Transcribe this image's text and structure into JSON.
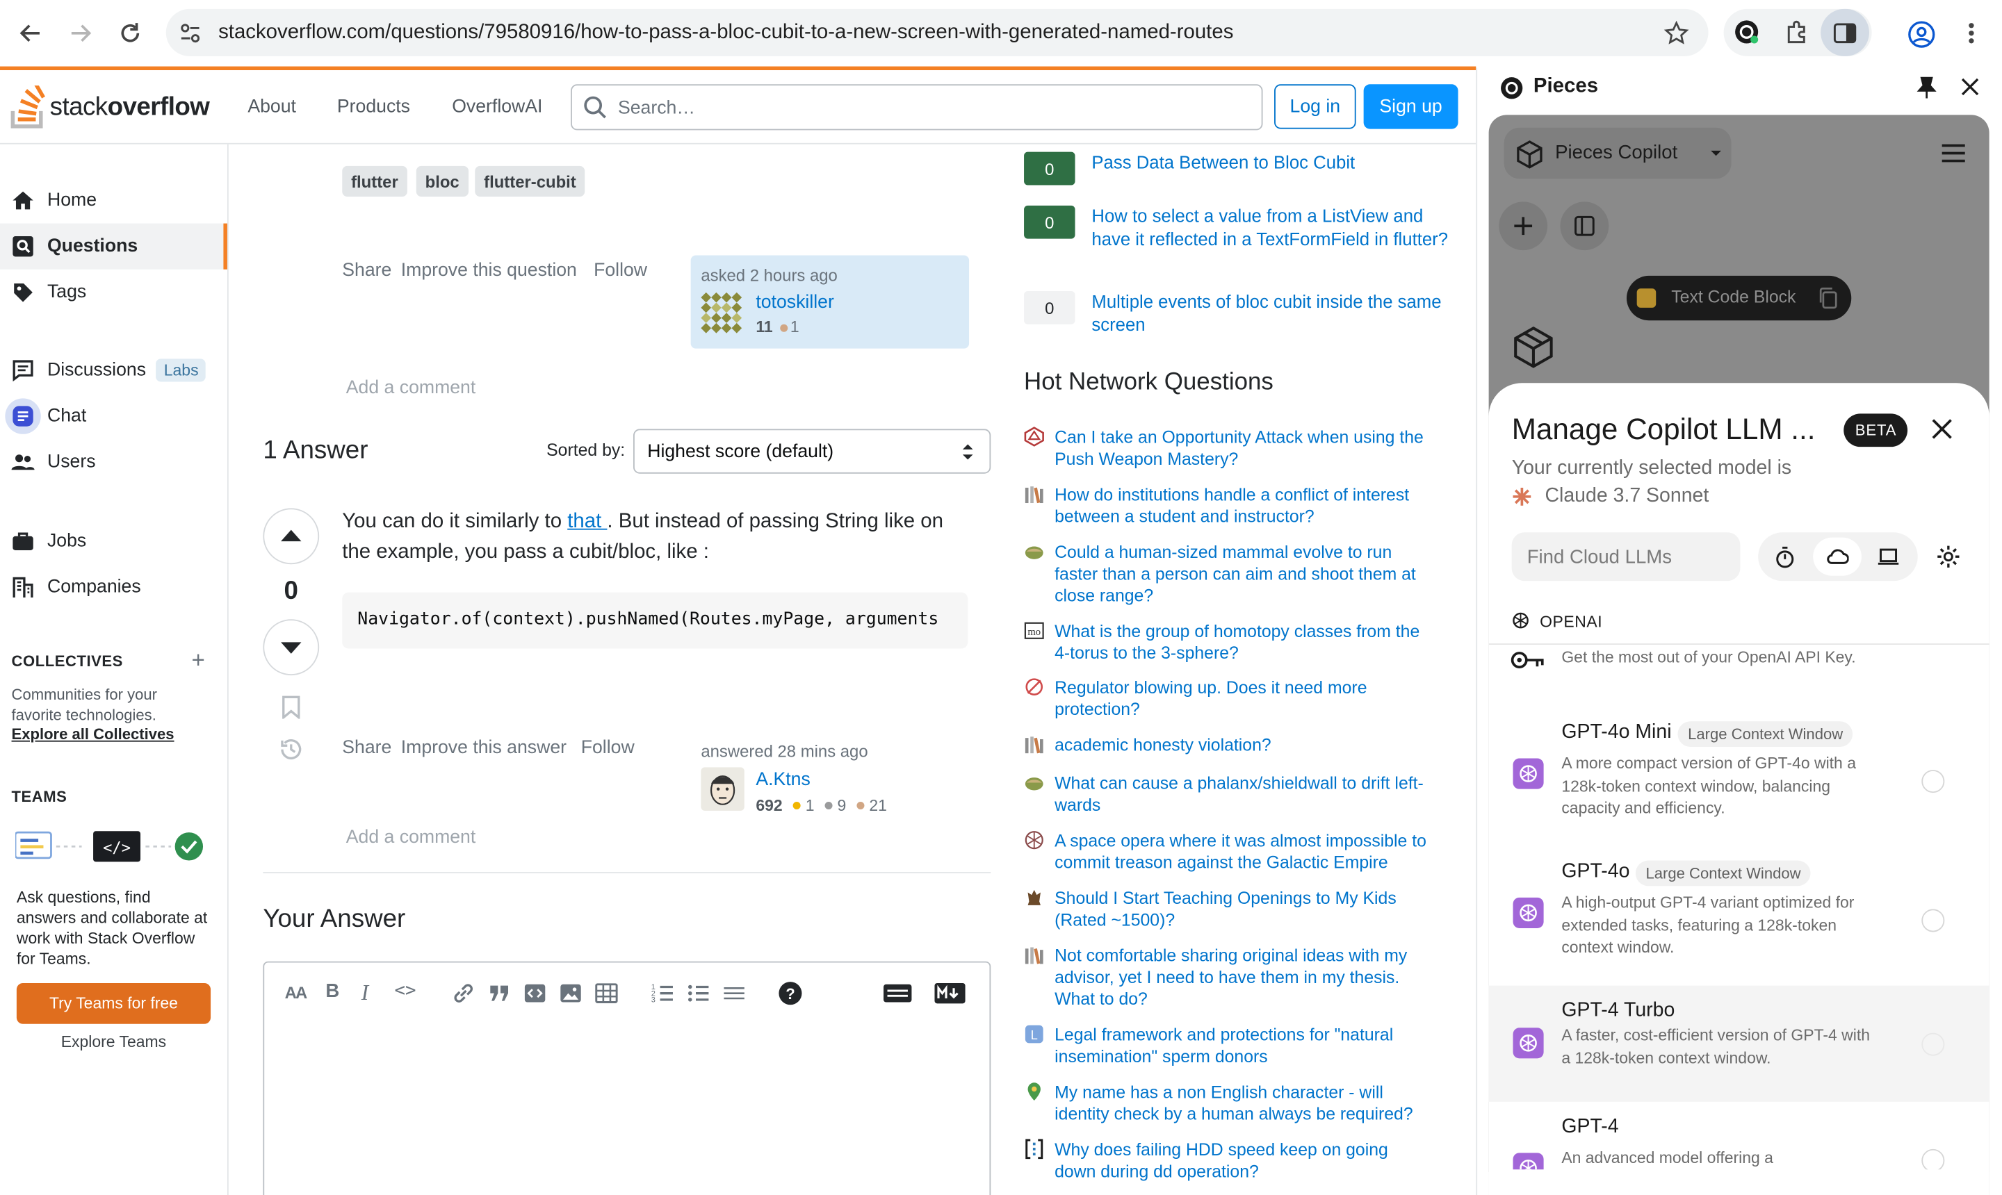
{
  "browser": {
    "url": "stackoverflow.com/questions/79580916/how-to-pass-a-bloc-cubit-to-a-new-screen-with-generated-named-routes"
  },
  "so": {
    "logo_text_a": "stack",
    "logo_text_b": "overflow",
    "nav": [
      "About",
      "Products",
      "OverflowAI"
    ],
    "search_placeholder": "Search…",
    "login": "Log in",
    "signup": "Sign up",
    "leftnav": {
      "home": "Home",
      "questions": "Questions",
      "tags": "Tags",
      "discussions": "Discussions",
      "labs": "Labs",
      "chat": "Chat",
      "users": "Users",
      "jobs": "Jobs",
      "companies": "Companies"
    },
    "collectives": {
      "title": "COLLECTIVES",
      "desc": "Communities for your favorite technologies.",
      "link": "Explore all Collectives"
    },
    "teams": {
      "title": "TEAMS",
      "desc": "Ask questions, find answers and collaborate at work with Stack Overflow for Teams.",
      "cta": "Try Teams for free",
      "explore": "Explore Teams"
    },
    "question": {
      "tags": [
        "flutter",
        "bloc",
        "flutter-cubit"
      ],
      "share": "Share",
      "improve": "Improve this question",
      "follow": "Follow",
      "asked": "asked 2 hours ago",
      "user": "totoskiller",
      "rep": "11",
      "bronze": "1",
      "add_comment": "Add a comment"
    },
    "answers": {
      "count_label": "1 Answer",
      "sorted_label": "Sorted by:",
      "sort_value": "Highest score (default)",
      "score": "0",
      "body_1": "You can do it similarly to ",
      "body_link": "that ",
      "body_2": ". But instead of passing String like on the example, you pass a cubit/bloc, like :",
      "code": "Navigator.of(context).pushNamed(Routes.myPage, arguments",
      "share": "Share",
      "improve": "Improve this answer",
      "follow": "Follow",
      "answered": "answered 28 mins ago",
      "user": "A.Ktns",
      "rep": "692",
      "gold": "1",
      "silver": "9",
      "bronze": "21",
      "add_comment": "Add a comment"
    },
    "your_answer": "Your Answer",
    "related": [
      {
        "score": "0",
        "title": "Pass Data Between to Bloc Cubit",
        "answered": true
      },
      {
        "score": "0",
        "title": "How to select a value from a ListView and have it reflected in a TextFormField in flutter?",
        "answered": true
      },
      {
        "score": "0",
        "title": "Multiple events of bloc cubit inside the same screen",
        "answered": false
      }
    ],
    "hnq_title": "Hot Network Questions",
    "hnq": [
      "Can I take an Opportunity Attack when using the Push Weapon Mastery?",
      "How do institutions handle a conflict of interest between a student and instructor?",
      "Could a human-sized mammal evolve to run faster than a person can aim and shoot them at close range?",
      "What is the group of homotopy classes from the 4-torus to the 3-sphere?",
      "Regulator blowing up. Does it need more protection?",
      "academic honesty violation?",
      "What can cause a phalanx/shieldwall to drift left-wards",
      "A space opera where it was almost impossible to commit treason against the Galactic Empire",
      "Should I Start Teaching Openings to My Kids (Rated ~1500)?",
      "Not comfortable sharing original ideas with my advisor, yet I need to have them in my thesis. What to do?",
      "Legal framework and protections for \"natural insemination\" sperm donors",
      "My name has a non English character - will identity check by a human always be required?",
      "Why does failing HDD speed keep on going down during dd operation?"
    ]
  },
  "pieces": {
    "title": "Pieces",
    "copilot_label": "Pieces Copilot",
    "chip": "Text Code Block",
    "sheet_title": "Manage Copilot LLM ...",
    "beta": "BETA",
    "selected_label": "Your currently selected model is",
    "selected_model": "Claude 3.7 Sonnet",
    "find_placeholder": "Find Cloud LLMs",
    "provider": "OPENAI",
    "key_desc": "Get the most out of your OpenAI API Key.",
    "models": [
      {
        "name": "GPT-4o Mini",
        "badge": "Large Context Window",
        "desc": "A more compact version of GPT-4o with a 128k-token context window, balancing capacity and efficiency."
      },
      {
        "name": "GPT-4o",
        "badge": "Large Context Window",
        "desc": "A high-output GPT-4 variant optimized for extended tasks, featuring a 128k-token context window."
      },
      {
        "name": "GPT-4 Turbo",
        "badge": "",
        "desc": "A faster, cost-efficient version of GPT-4 with a 128k-token context window."
      },
      {
        "name": "GPT-4",
        "badge": "",
        "desc": "An advanced model offering a"
      }
    ]
  },
  "colors": {
    "so_orange": "#f48024",
    "so_blue": "#0074cc",
    "accepted_green": "#2f6f44",
    "pieces_accent": "#a266d8"
  }
}
